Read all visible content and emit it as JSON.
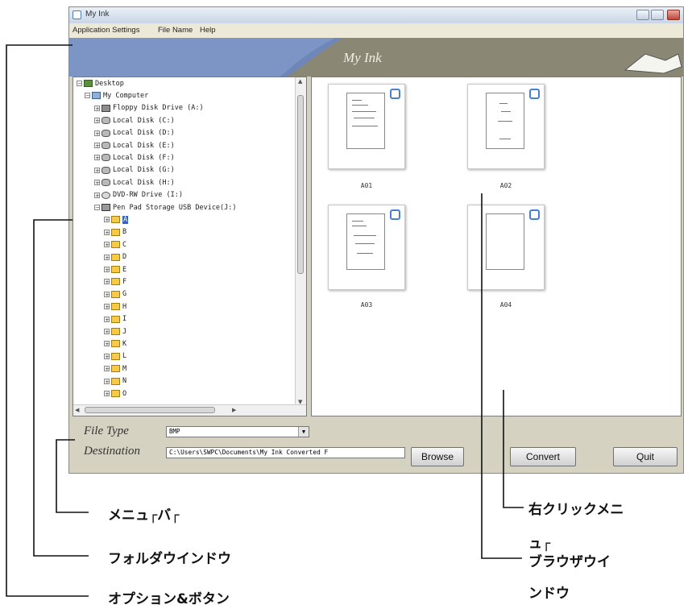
{
  "window": {
    "title": "My Ink",
    "banner_title": "My Ink"
  },
  "menu": {
    "items": [
      "Application Settings",
      "File Name",
      "Help"
    ]
  },
  "folder_tree": {
    "items": [
      {
        "label": "Desktop",
        "icon": "desktop-icon",
        "expander": "−"
      },
      {
        "label": "My Computer",
        "icon": "computer-icon",
        "expander": "−"
      },
      {
        "label": "Floppy Disk Drive (A:)",
        "icon": "floppy-disk-icon",
        "expander": "+"
      },
      {
        "label": "Local Disk (C:)",
        "icon": "hard-disk-icon",
        "expander": "+"
      },
      {
        "label": "Local Disk (D:)",
        "icon": "hard-disk-icon",
        "expander": "+"
      },
      {
        "label": "Local Disk (E:)",
        "icon": "hard-disk-icon",
        "expander": "+"
      },
      {
        "label": "Local Disk (F:)",
        "icon": "hard-disk-icon",
        "expander": "+"
      },
      {
        "label": "Local Disk (G:)",
        "icon": "hard-disk-icon",
        "expander": "+"
      },
      {
        "label": "Local Disk (H:)",
        "icon": "hard-disk-icon",
        "expander": "+"
      },
      {
        "label": "DVD-RW Drive (I:)",
        "icon": "dvd-drive-icon",
        "expander": "+"
      },
      {
        "label": "Pen Pad Storage USB Device(J:)",
        "icon": "usb-device-icon",
        "expander": "−"
      },
      {
        "label": "A",
        "icon": "folder-icon",
        "expander": "+",
        "selected": true
      },
      {
        "label": "B",
        "icon": "folder-icon",
        "expander": "+"
      },
      {
        "label": "C",
        "icon": "folder-icon",
        "expander": "+"
      },
      {
        "label": "D",
        "icon": "folder-icon",
        "expander": "+"
      },
      {
        "label": "E",
        "icon": "folder-icon",
        "expander": "+"
      },
      {
        "label": "F",
        "icon": "folder-icon",
        "expander": "+"
      },
      {
        "label": "G",
        "icon": "folder-icon",
        "expander": "+"
      },
      {
        "label": "H",
        "icon": "folder-icon",
        "expander": "+"
      },
      {
        "label": "I",
        "icon": "folder-icon",
        "expander": "+"
      },
      {
        "label": "J",
        "icon": "folder-icon",
        "expander": "+"
      },
      {
        "label": "K",
        "icon": "folder-icon",
        "expander": "+"
      },
      {
        "label": "L",
        "icon": "folder-icon",
        "expander": "+"
      },
      {
        "label": "M",
        "icon": "folder-icon",
        "expander": "+"
      },
      {
        "label": "N",
        "icon": "folder-icon",
        "expander": "+"
      },
      {
        "label": "O",
        "icon": "folder-icon",
        "expander": "+"
      }
    ]
  },
  "thumbnails": [
    {
      "name": "A01"
    },
    {
      "name": "A02"
    },
    {
      "name": "A03"
    },
    {
      "name": "A04"
    }
  ],
  "bottom": {
    "file_type_label": "File Type",
    "file_type_value": "BMP",
    "destination_label": "Destination",
    "destination_value": "C:\\Users\\SWPC\\Documents\\My Ink Converted F",
    "browse_label": "Browse",
    "convert_label": "Convert",
    "quit_label": "Quit"
  },
  "annotations": {
    "menu_bar": "メニュ┌バ┌",
    "folder_window": "フォルダウインドウ",
    "options_buttons": "オプション&ボタン",
    "right_click_menu_1": "右クリックメニ",
    "right_click_menu_2": "ュ┌",
    "browser_window_1": "ブラウザウイ",
    "browser_window_2": "ンドウ"
  },
  "colors": {
    "selection": "#3163c5",
    "checkbox": "#4a7fd0",
    "banner": "#8a8774",
    "window_bg": "#d6d2c2"
  }
}
